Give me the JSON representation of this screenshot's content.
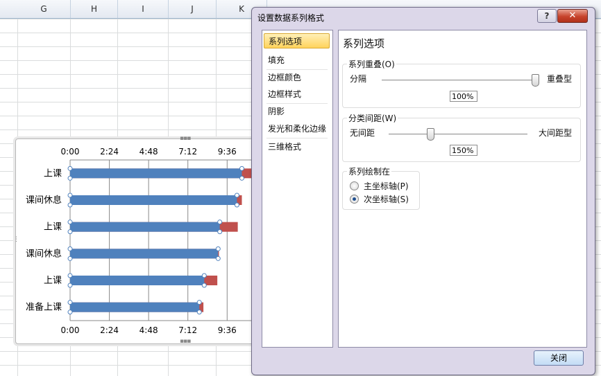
{
  "sheet": {
    "columns": [
      "G",
      "H",
      "I",
      "J",
      "K"
    ]
  },
  "chart_data": {
    "type": "bar",
    "orientation": "horizontal",
    "categories": [
      "上课",
      "课间休息",
      "上课",
      "课间休息",
      "上课",
      "准备上课"
    ],
    "series": [
      {
        "values_hours": [
          10.5,
          10.2,
          9.15,
          9.05,
          8.2,
          7.9
        ],
        "color": "#4f81bd"
      },
      {
        "values_hours": [
          11.3,
          10.5,
          10.25,
          9.1,
          9.0,
          8.15
        ],
        "color": "#c0504d"
      }
    ],
    "xlim_hours": [
      0,
      11.2
    ],
    "x_ticks": [
      "0:00",
      "2:24",
      "4:48",
      "7:12",
      "9:36"
    ],
    "grid": true,
    "axes": "top and bottom"
  },
  "dialog": {
    "title": "设置数据系列格式",
    "help_label": "?",
    "close_glyph": "✕",
    "nav": [
      {
        "label": "系列选项",
        "selected": true
      },
      {
        "label": "填充",
        "selected": false
      },
      {
        "label": "边框颜色",
        "selected": false
      },
      {
        "label": "边框样式",
        "selected": false
      },
      {
        "label": "阴影",
        "selected": false
      },
      {
        "label": "发光和柔化边缘",
        "selected": false
      },
      {
        "label": "三维格式",
        "selected": false
      }
    ],
    "heading": "系列选项",
    "overlap": {
      "label": "系列重叠(O)",
      "left": "分隔",
      "right": "重叠型",
      "value": "100%",
      "level": 1.0
    },
    "gap": {
      "label": "分类间距(W)",
      "left": "无间距",
      "right": "大间距型",
      "value": "150%",
      "level": 0.3
    },
    "plot_on": {
      "label": "系列绘制在",
      "options": [
        "主坐标轴(P)",
        "次坐标轴(S)"
      ],
      "selected_index": 1
    },
    "close_button": "关闭"
  }
}
